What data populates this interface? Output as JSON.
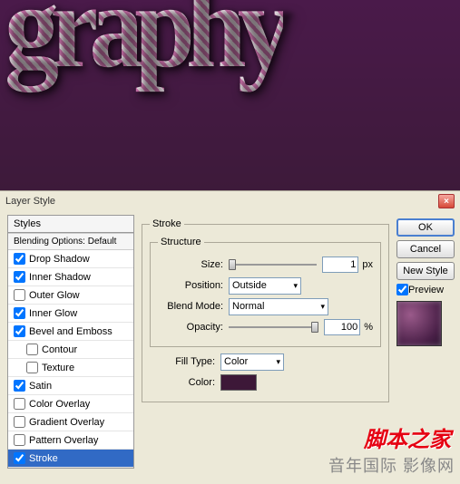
{
  "preview_text": "graphy",
  "dialog": {
    "title": "Layer Style",
    "styles_header": "Styles",
    "blending_options": "Blending Options: Default",
    "items": [
      {
        "label": "Drop Shadow",
        "checked": true
      },
      {
        "label": "Inner Shadow",
        "checked": true
      },
      {
        "label": "Outer Glow",
        "checked": false
      },
      {
        "label": "Inner Glow",
        "checked": true
      },
      {
        "label": "Bevel and Emboss",
        "checked": true
      },
      {
        "label": "Contour",
        "checked": false,
        "indent": true
      },
      {
        "label": "Texture",
        "checked": false,
        "indent": true
      },
      {
        "label": "Satin",
        "checked": true
      },
      {
        "label": "Color Overlay",
        "checked": false
      },
      {
        "label": "Gradient Overlay",
        "checked": false
      },
      {
        "label": "Pattern Overlay",
        "checked": false
      },
      {
        "label": "Stroke",
        "checked": true,
        "selected": true
      }
    ]
  },
  "stroke": {
    "title": "Stroke",
    "structure": "Structure",
    "size_label": "Size:",
    "size_value": "1",
    "size_unit": "px",
    "position_label": "Position:",
    "position_value": "Outside",
    "blend_label": "Blend Mode:",
    "blend_value": "Normal",
    "opacity_label": "Opacity:",
    "opacity_value": "100",
    "opacity_unit": "%",
    "fill_type_label": "Fill Type:",
    "fill_type_value": "Color",
    "color_label": "Color:",
    "color_value": "#3d1838"
  },
  "buttons": {
    "ok": "OK",
    "cancel": "Cancel",
    "new_style": "New Style",
    "preview": "Preview"
  },
  "watermark1": "脚本之家",
  "watermark2": "音年国际 影像网"
}
